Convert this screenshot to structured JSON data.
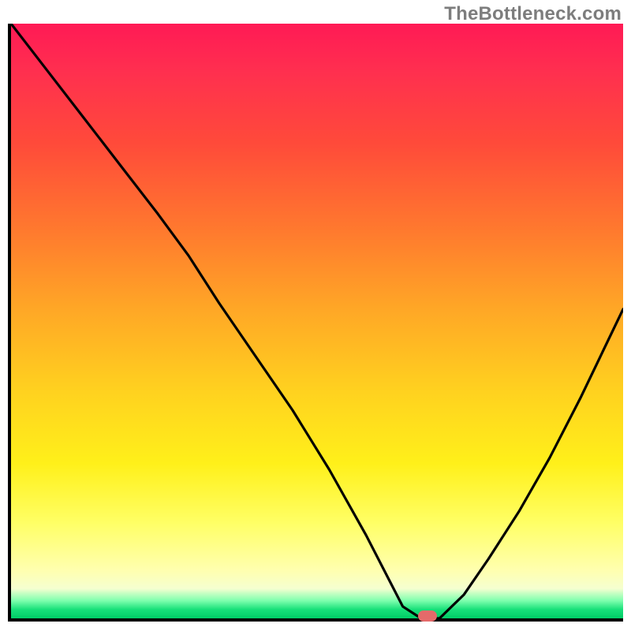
{
  "watermark": "TheBottleneck.com",
  "chart_data": {
    "type": "line",
    "title": "",
    "xlabel": "",
    "ylabel": "",
    "xlim": [
      0,
      100
    ],
    "ylim": [
      0,
      100
    ],
    "grid": false,
    "legend": false,
    "series": [
      {
        "name": "bottleneck-curve",
        "x": [
          0,
          6,
          12,
          18,
          24,
          29,
          34,
          40,
          46,
          52,
          58,
          62,
          64,
          67,
          70,
          74,
          78,
          83,
          88,
          93,
          100
        ],
        "y": [
          100,
          92,
          84,
          76,
          68,
          61,
          53,
          44,
          35,
          25,
          14,
          6,
          2,
          0,
          0,
          4,
          10,
          18,
          27,
          37,
          52
        ]
      }
    ],
    "annotations": [
      {
        "name": "optimal-marker",
        "x": 68,
        "y": 0
      }
    ],
    "background_gradient": {
      "direction": "vertical",
      "stops": [
        {
          "pos": 0.0,
          "color": "#ff1a55"
        },
        {
          "pos": 0.35,
          "color": "#ff7a2e"
        },
        {
          "pos": 0.62,
          "color": "#ffd21f"
        },
        {
          "pos": 0.92,
          "color": "#ffffb0"
        },
        {
          "pos": 0.98,
          "color": "#18e07a"
        },
        {
          "pos": 1.0,
          "color": "#00cc66"
        }
      ]
    }
  }
}
